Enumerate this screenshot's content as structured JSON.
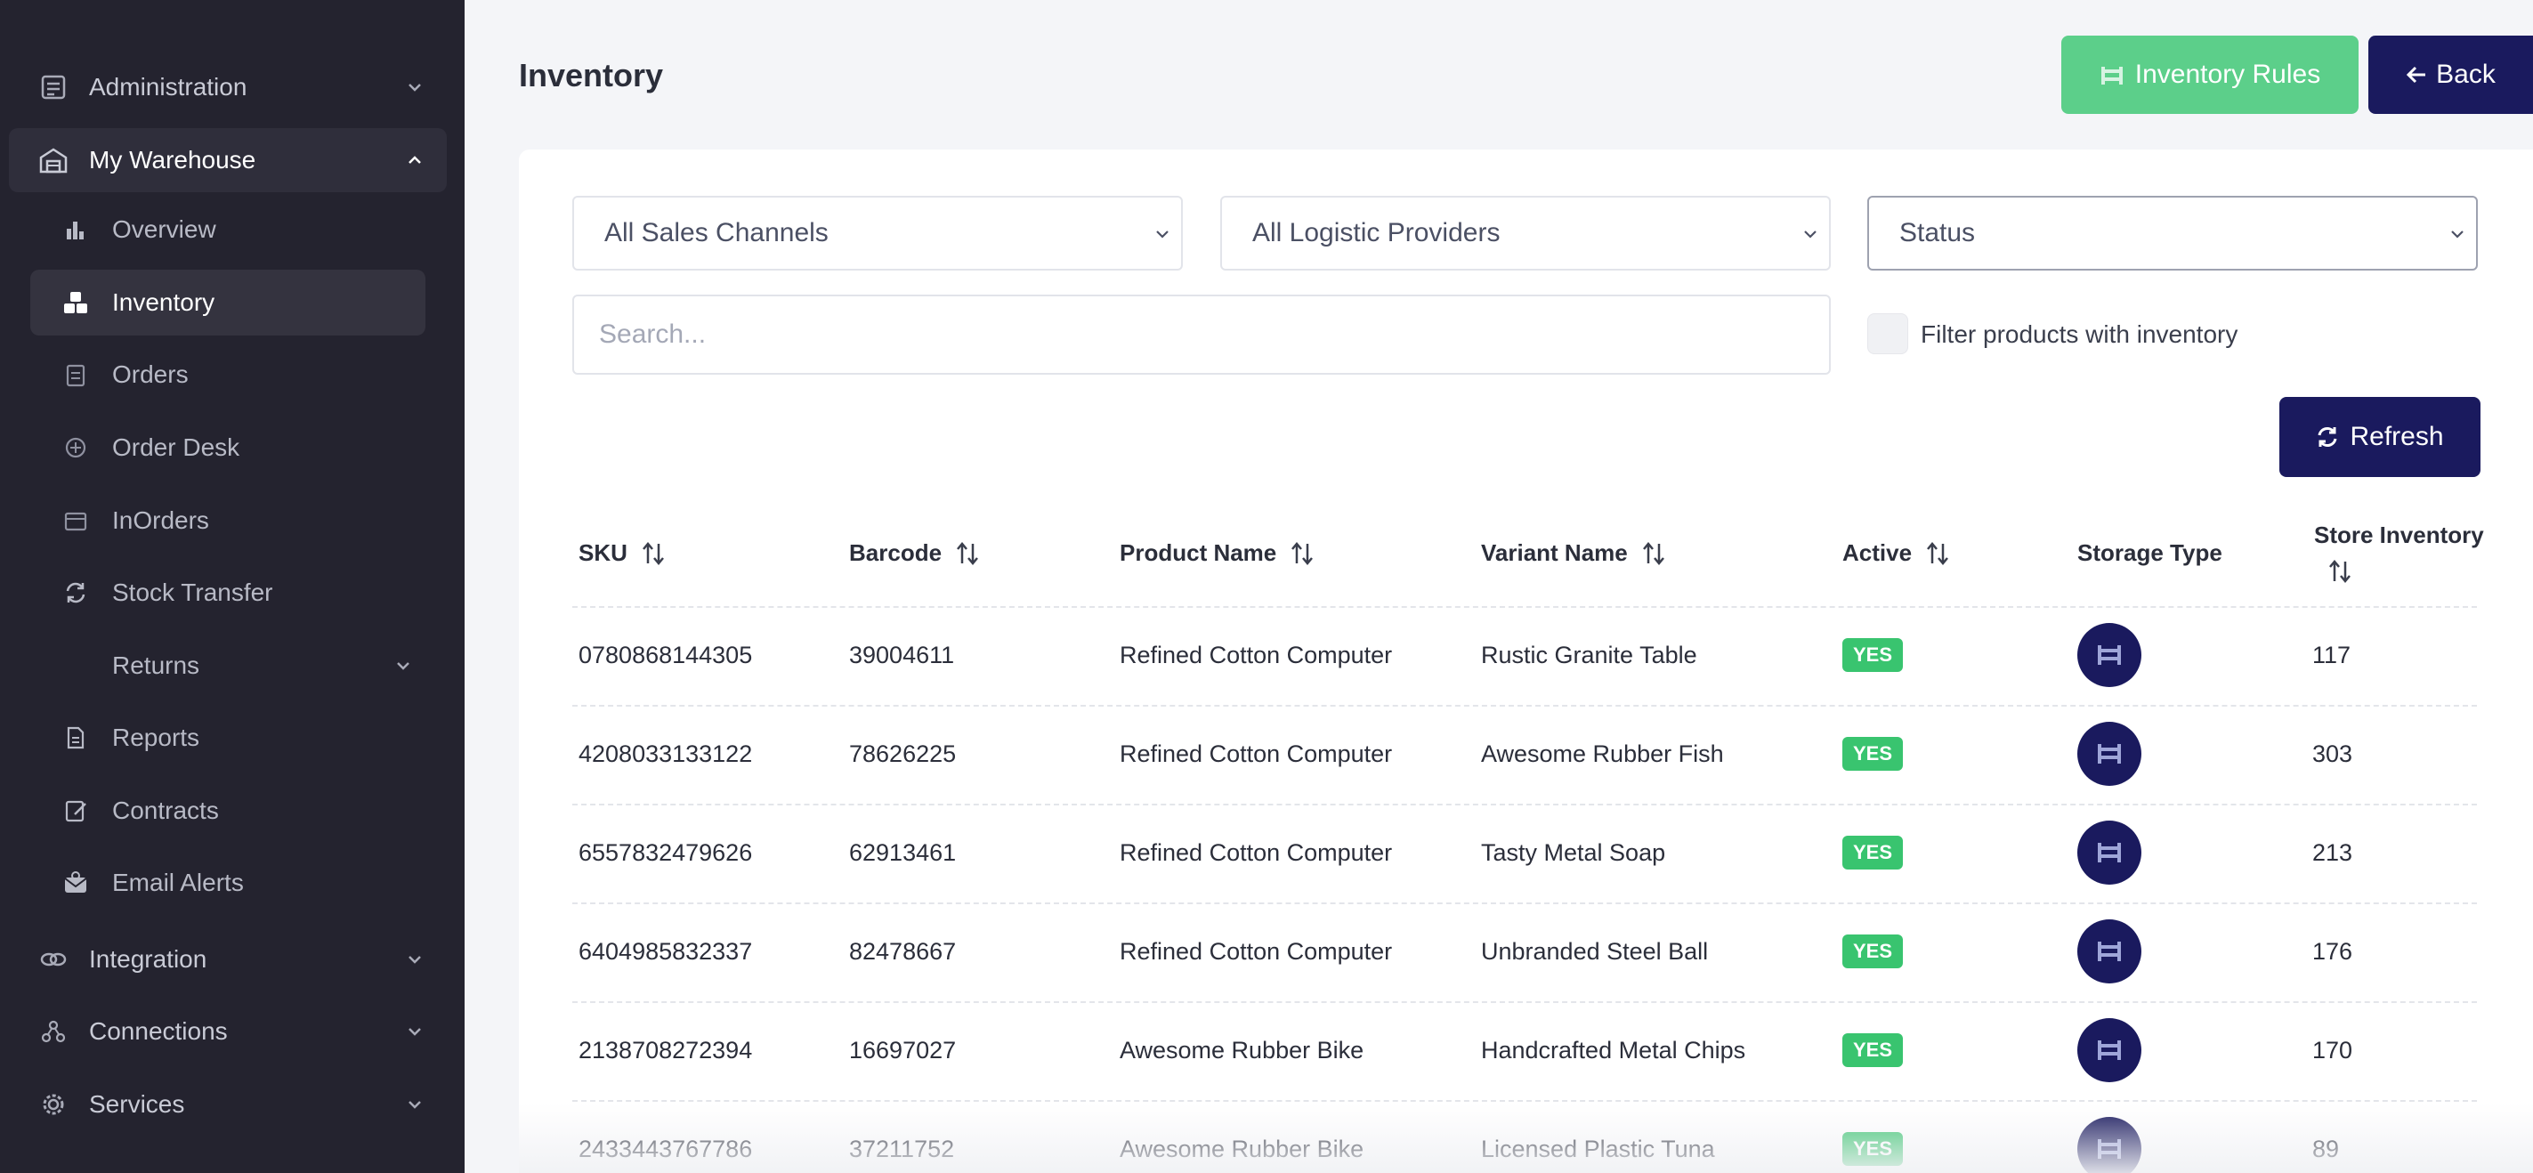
{
  "sidebar": {
    "administration": "Administration",
    "my_warehouse": "My Warehouse",
    "sub_items": [
      {
        "label": "Overview",
        "icon": "chart-bar-icon"
      },
      {
        "label": "Inventory",
        "icon": "boxes-icon"
      },
      {
        "label": "Orders",
        "icon": "clipboard-icon"
      },
      {
        "label": "Order Desk",
        "icon": "desk-icon"
      },
      {
        "label": "InOrders",
        "icon": "inbox-icon"
      },
      {
        "label": "Stock Transfer",
        "icon": "sync-icon"
      },
      {
        "label": "Returns",
        "icon": "return-icon"
      },
      {
        "label": "Reports",
        "icon": "document-icon"
      },
      {
        "label": "Contracts",
        "icon": "contract-icon"
      },
      {
        "label": "Email Alerts",
        "icon": "mail-alert-icon"
      }
    ],
    "integration": "Integration",
    "connections": "Connections",
    "services": "Services"
  },
  "header": {
    "title": "Inventory",
    "rules_button": "Inventory Rules",
    "back_button": "Back"
  },
  "filters": {
    "sales_channels": "All Sales Channels",
    "logistic_providers": "All Logistic Providers",
    "status": "Status",
    "search_placeholder": "Search...",
    "inventory_filter_label": "Filter products with inventory",
    "refresh_button": "Refresh"
  },
  "table": {
    "headers": {
      "sku": "SKU",
      "barcode": "Barcode",
      "product": "Product Name",
      "variant": "Variant Name",
      "active": "Active",
      "storage": "Storage Type",
      "store_inventory": "Store Inventory"
    },
    "rows": [
      {
        "sku": "0780868144305",
        "barcode": "39004611",
        "product": "Refined Cotton Computer",
        "variant": "Rustic Granite Table",
        "active": "YES",
        "inventory": "117"
      },
      {
        "sku": "4208033133122",
        "barcode": "78626225",
        "product": "Refined Cotton Computer",
        "variant": "Awesome Rubber Fish",
        "active": "YES",
        "inventory": "303"
      },
      {
        "sku": "6557832479626",
        "barcode": "62913461",
        "product": "Refined Cotton Computer",
        "variant": "Tasty Metal Soap",
        "active": "YES",
        "inventory": "213"
      },
      {
        "sku": "6404985832337",
        "barcode": "82478667",
        "product": "Refined Cotton Computer",
        "variant": "Unbranded Steel Ball",
        "active": "YES",
        "inventory": "176"
      },
      {
        "sku": "2138708272394",
        "barcode": "16697027",
        "product": "Awesome Rubber Bike",
        "variant": "Handcrafted Metal Chips",
        "active": "YES",
        "inventory": "170"
      },
      {
        "sku": "2433443767786",
        "barcode": "37211752",
        "product": "Awesome Rubber Bike",
        "variant": "Licensed Plastic Tuna",
        "active": "YES",
        "inventory": "89"
      }
    ]
  },
  "colors": {
    "sidebar_bg": "#24232f",
    "primary": "#1a1a5e",
    "success": "#5ccf8a",
    "badge": "#39c46f"
  }
}
